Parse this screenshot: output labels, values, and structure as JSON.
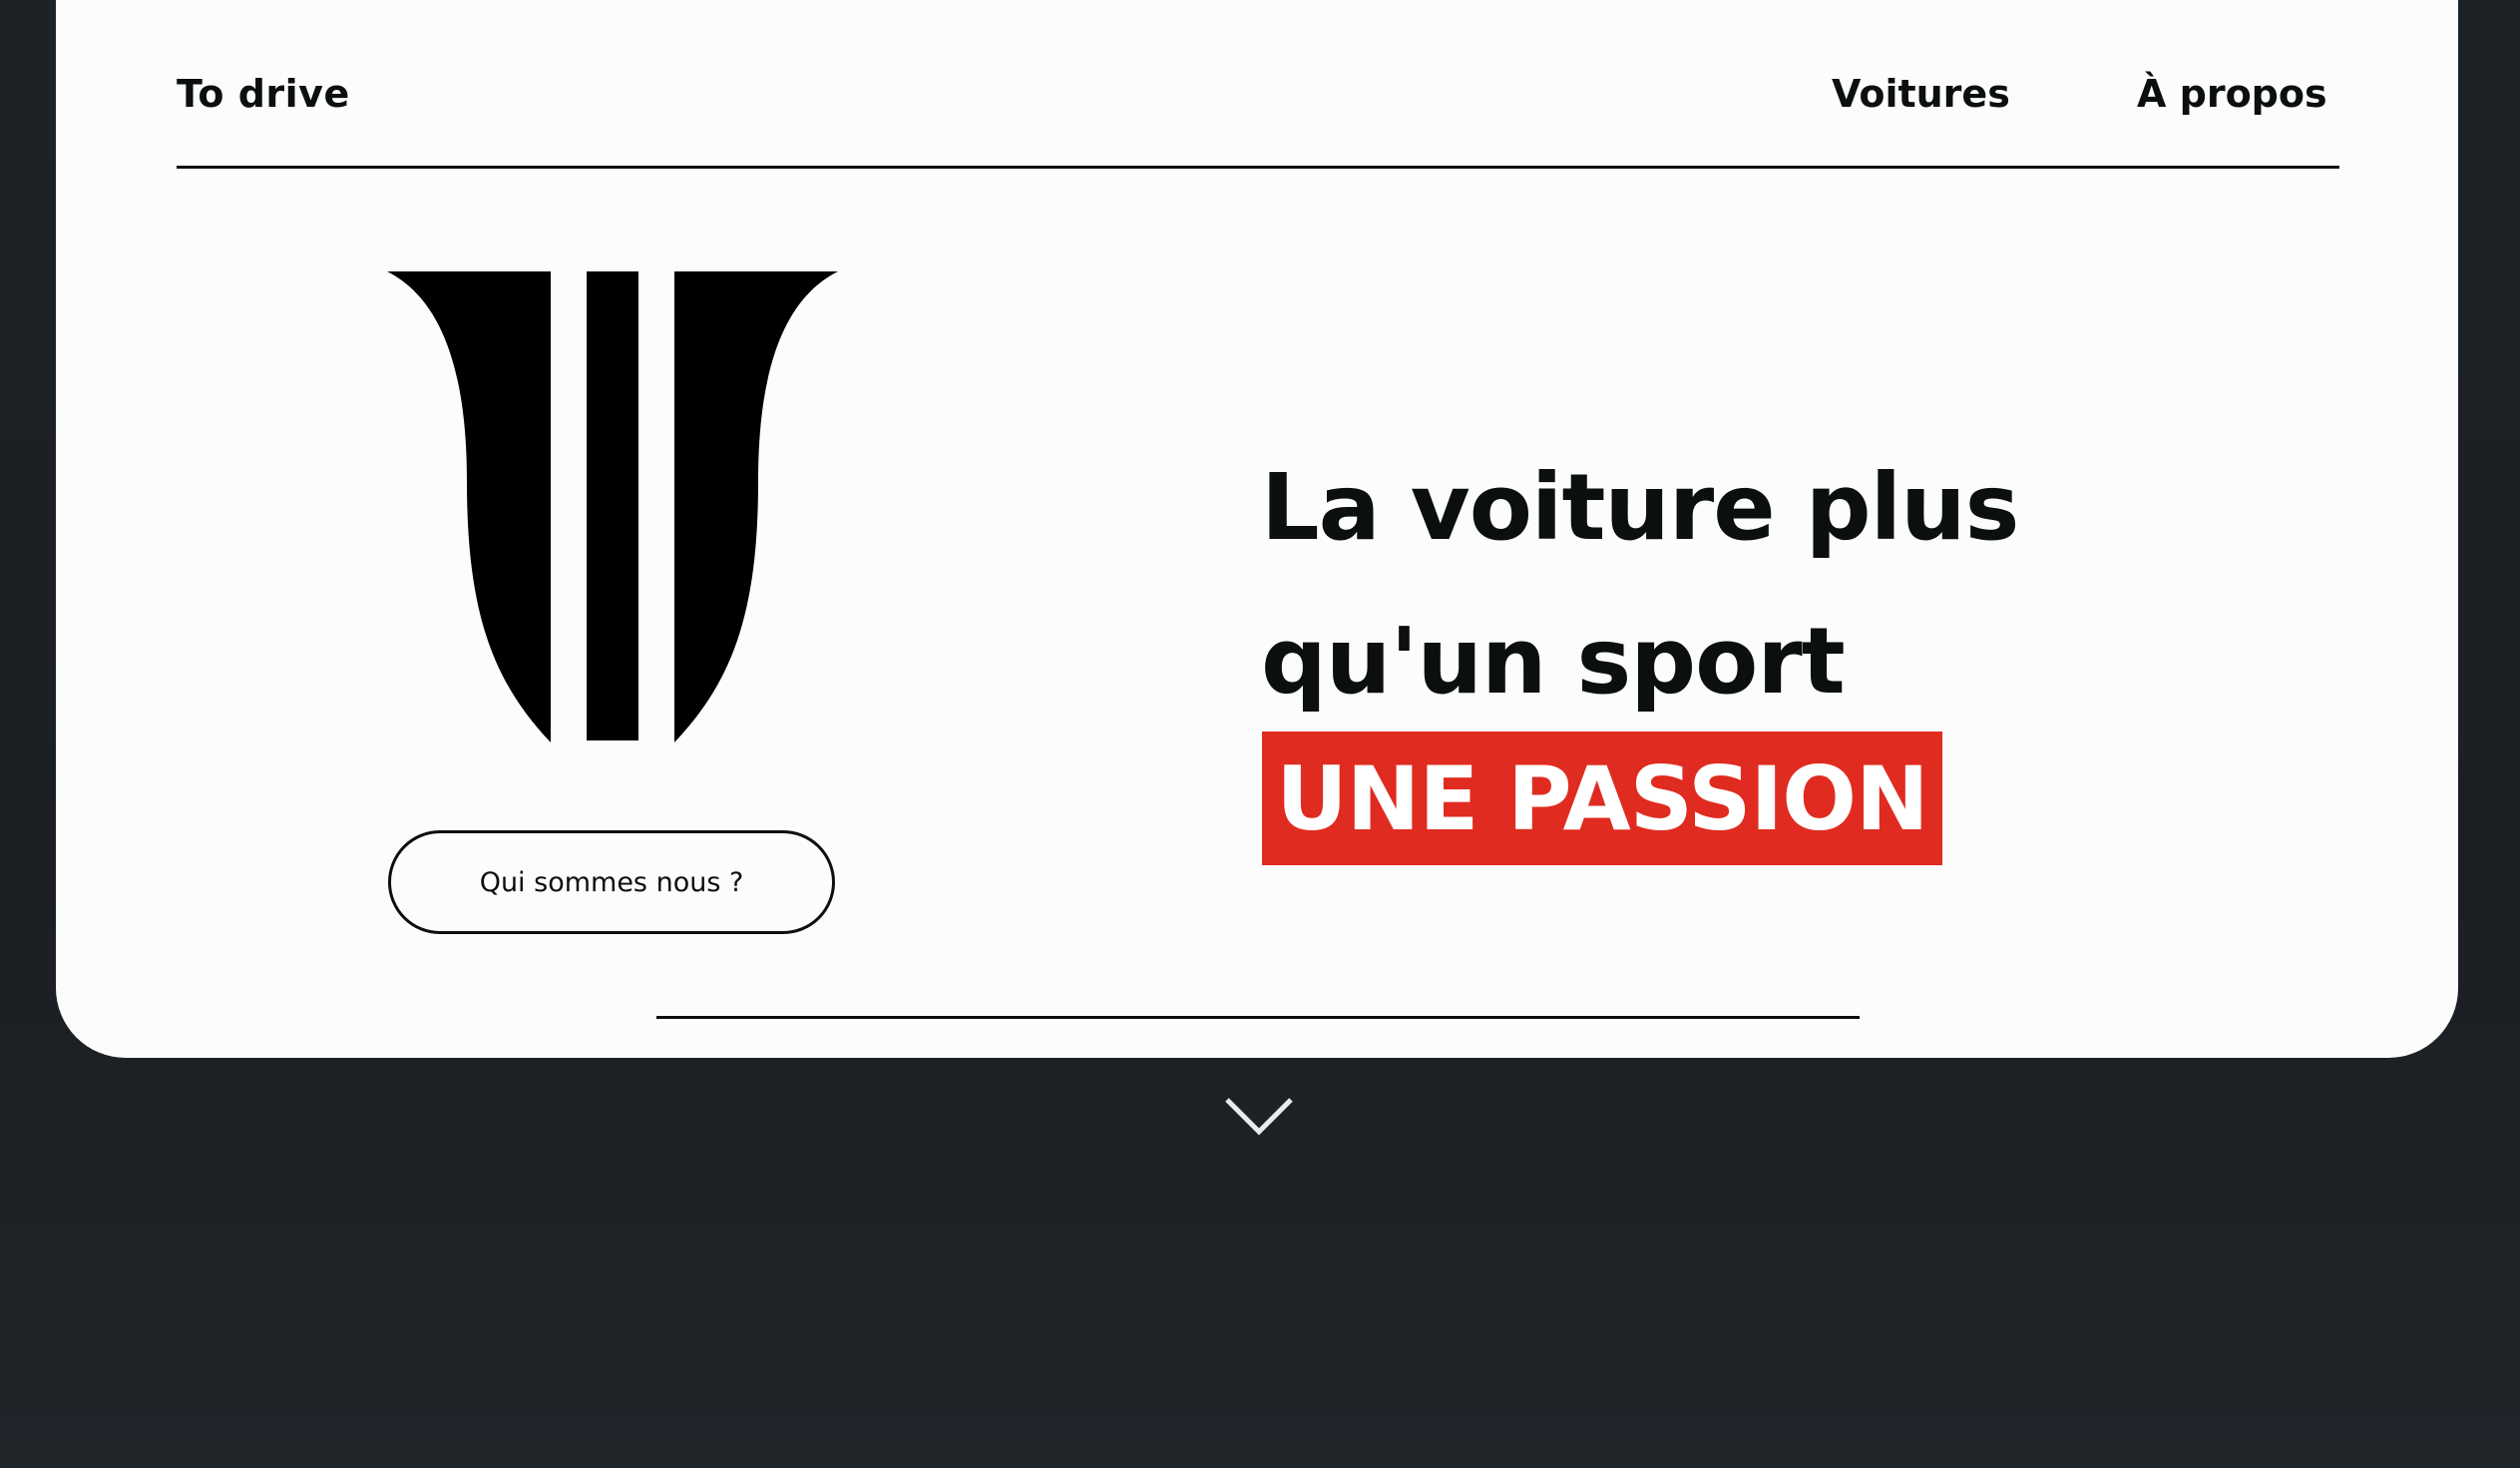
{
  "header": {
    "brand": "To drive",
    "nav": [
      {
        "label": "Voitures"
      },
      {
        "label": "À propos"
      }
    ]
  },
  "hero": {
    "headline_lines": [
      "La voiture plus",
      "qu'un sport"
    ],
    "highlight": "UNE PASSION",
    "cta_label": "Qui sommes nous ?"
  },
  "icons": {
    "logo": "brand-logo",
    "scroll": "chevron-down-icon"
  },
  "colors": {
    "accent": "#e02b20",
    "text": "#0c0f0f",
    "card_background": "#fcfcfc",
    "page_background": "#1d2226"
  }
}
